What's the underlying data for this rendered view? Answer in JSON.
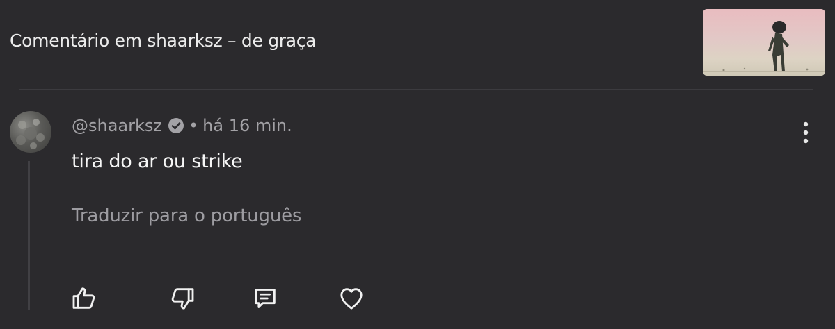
{
  "header": {
    "title": "Comentário em shaarksz – de graça"
  },
  "comment": {
    "author": "@shaarksz",
    "separator": "•",
    "time": "há 16 min.",
    "text": "tira do ar ou strike",
    "translate_label": "Traduzir para o português"
  },
  "actions": {
    "like_icon": "thumbs-up-icon",
    "dislike_icon": "thumbs-down-icon",
    "reply_icon": "reply-comment-icon",
    "heart_icon": "heart-icon",
    "menu_icon": "more-vert-icon"
  },
  "colors": {
    "background": "#2b2a2d",
    "primary_text": "#f6f6f6",
    "secondary_text": "#a3a2a6"
  }
}
